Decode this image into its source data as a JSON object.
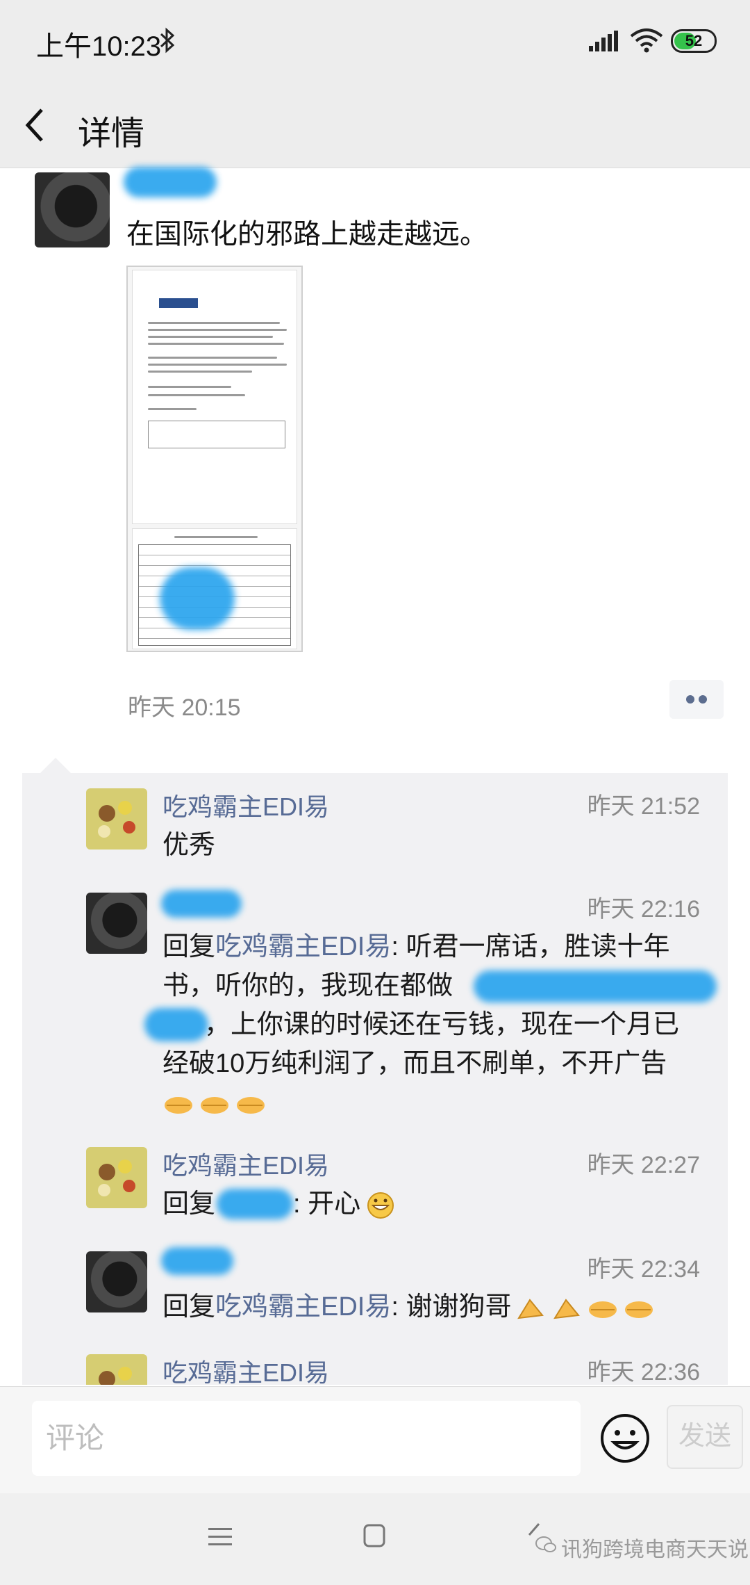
{
  "status_bar": {
    "time": "上午10:23",
    "battery": "52",
    "battery_level": 0.52
  },
  "header": {
    "title": "详情"
  },
  "post": {
    "text": "在国际化的邪路上越走越远。",
    "time": "昨天 20:15"
  },
  "comments": [
    {
      "author": "吃鸡霸主EDI易",
      "time": "昨天 21:52",
      "text": "优秀"
    },
    {
      "author": "",
      "time": "昨天 22:16",
      "reply_prefix": "回复",
      "reply_to": "吃鸡霸主EDI易",
      "lines": [
        ": 听君一席话，胜读十年",
        "书，听你的，我现在都做",
        "，上你课的时候还在亏钱，现在一个月已",
        "经破10万纯利润了，而且不刷单，不开广告"
      ]
    },
    {
      "author": "吃鸡霸主EDI易",
      "time": "昨天 22:27",
      "reply_prefix": "回复",
      "text": ": 开心"
    },
    {
      "author": "",
      "time": "昨天 22:34",
      "reply_prefix": "回复",
      "reply_to": "吃鸡霸主EDI易",
      "text": ": 谢谢狗哥"
    },
    {
      "author": "吃鸡霸主EDI易",
      "time": "昨天 22:36"
    }
  ],
  "input": {
    "placeholder": "评论",
    "send_label": "发送"
  },
  "watermark": "讯狗跨境电商天天说",
  "icons": [
    "bluetooth-icon",
    "signal-icon",
    "wifi-icon",
    "back-icon",
    "comment-icon",
    "emoji-icon",
    "menu-icon",
    "home-icon",
    "nav-back-icon",
    "wechat-icon"
  ]
}
